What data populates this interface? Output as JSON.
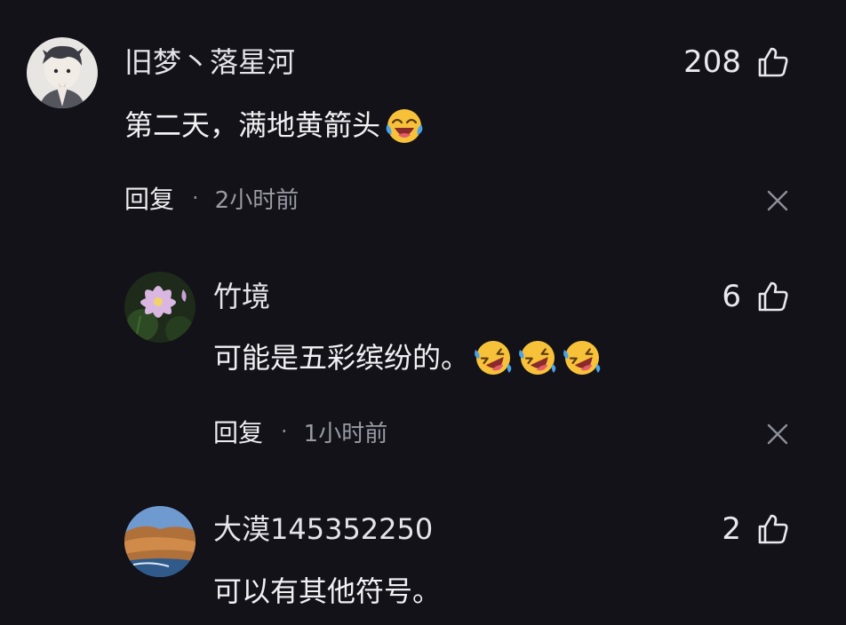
{
  "comments": [
    {
      "username": "旧梦丶落星河",
      "likes": "208",
      "text": "第二天，满地黄箭头",
      "emoji": [
        "joy-crying-emoji"
      ],
      "reply_label": "回复",
      "separator": "·",
      "time": "2小时前"
    },
    {
      "username": "竹境",
      "likes": "6",
      "text": "可能是五彩缤纷的。",
      "emoji": [
        "rolling-laughing-emoji",
        "rolling-laughing-emoji",
        "rolling-laughing-emoji"
      ],
      "reply_label": "回复",
      "separator": "·",
      "time": "1小时前"
    },
    {
      "username": "大漠145352250",
      "likes": "2",
      "text": "可以有其他符号。"
    }
  ],
  "icons": {
    "like": "thumbs-up-icon",
    "close": "close-icon"
  },
  "colors": {
    "background": "#121218",
    "text": "#f1f1f5",
    "muted": "#9a9aa3",
    "emoji_yellow": "#f7c23a"
  }
}
